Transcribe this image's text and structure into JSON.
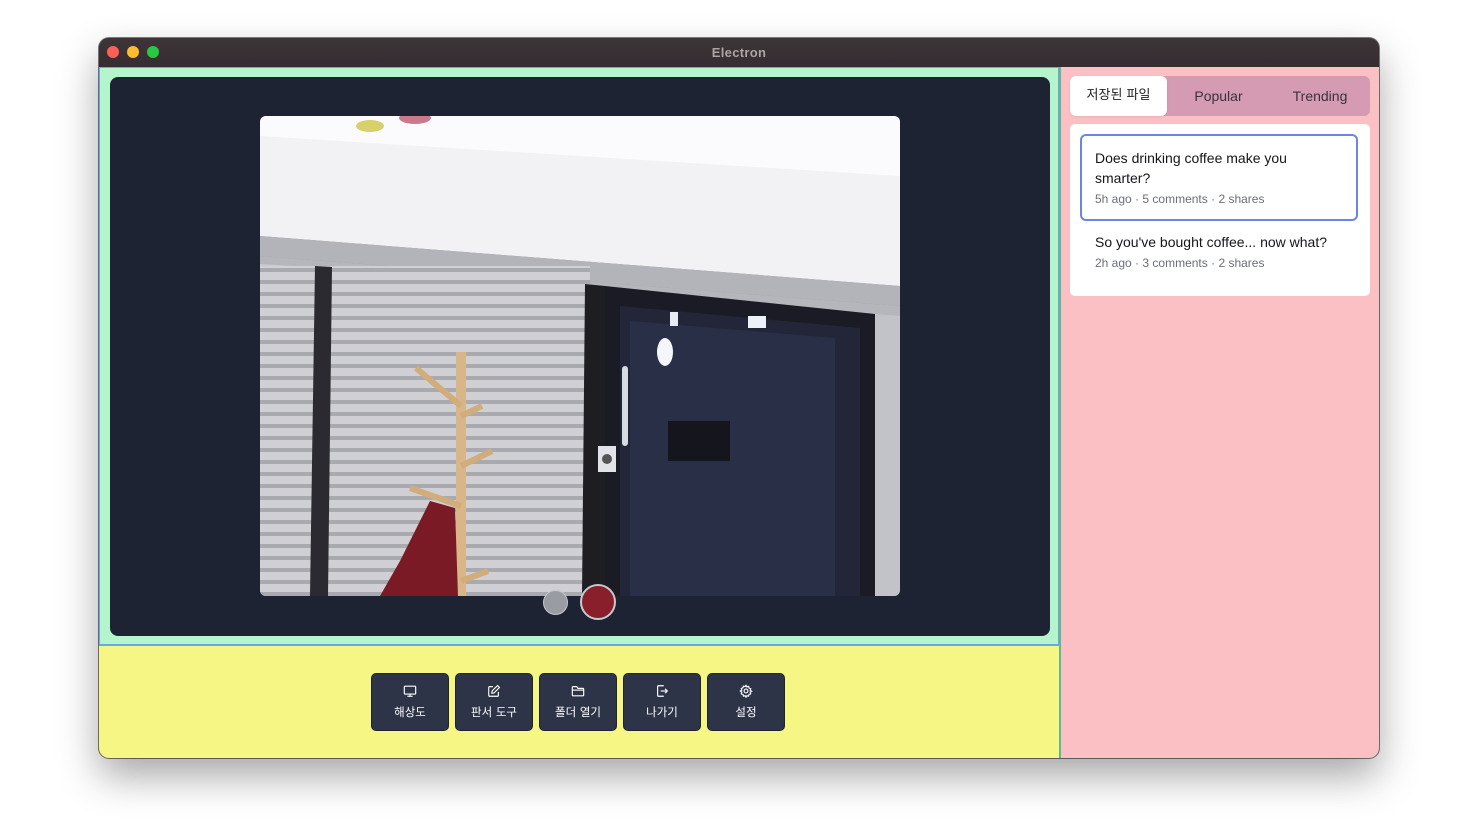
{
  "window": {
    "title": "Electron"
  },
  "toolbar": {
    "buttons": [
      {
        "label": "해상도",
        "icon": "monitor-icon"
      },
      {
        "label": "판서 도구",
        "icon": "pencil-square-icon"
      },
      {
        "label": "폴더 열기",
        "icon": "folder-open-icon"
      },
      {
        "label": "나가기",
        "icon": "exit-door-icon"
      },
      {
        "label": "설정",
        "icon": "gear-icon"
      }
    ]
  },
  "sidebar": {
    "tabs": [
      {
        "label": "저장된 파일",
        "active": true
      },
      {
        "label": "Popular",
        "active": false
      },
      {
        "label": "Trending",
        "active": false
      }
    ],
    "posts": [
      {
        "title": "Does drinking coffee make you smarter?",
        "time": "5h ago",
        "comments": "5 comments",
        "shares": "2 shares",
        "selected": true
      },
      {
        "title": "So you've bought coffee... now what?",
        "time": "2h ago",
        "comments": "3 comments",
        "shares": "2 shares",
        "selected": false
      }
    ],
    "separator": "·"
  },
  "colors": {
    "stage_bg": "#1e2333",
    "left_top_bg": "#b5f5cd",
    "left_bottom_bg": "#f6f685",
    "sidebar_bg": "#fbc0c4",
    "tabs_bg": "#d59bb2",
    "selected_border": "#6b84e6",
    "record_button": "#8a1f2c"
  }
}
